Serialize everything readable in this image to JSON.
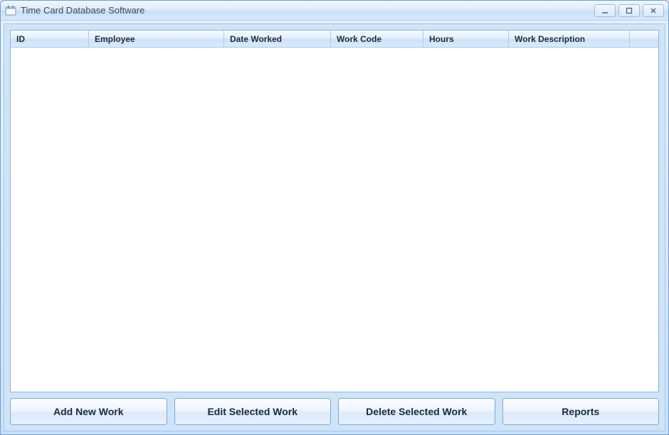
{
  "window": {
    "title": "Time Card Database Software"
  },
  "table": {
    "columns": [
      {
        "label": "ID"
      },
      {
        "label": "Employee"
      },
      {
        "label": "Date Worked"
      },
      {
        "label": "Work Code"
      },
      {
        "label": "Hours"
      },
      {
        "label": "Work Description"
      }
    ],
    "rows": []
  },
  "buttons": {
    "add": "Add New Work",
    "edit": "Edit Selected Work",
    "delete": "Delete Selected Work",
    "reports": "Reports"
  }
}
